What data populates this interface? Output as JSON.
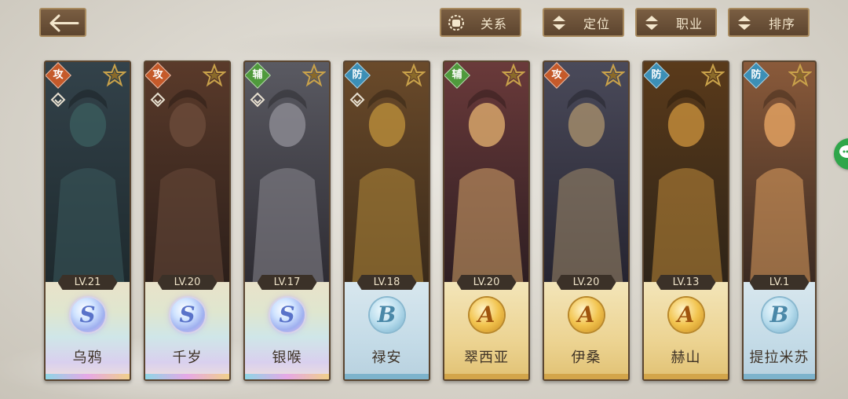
{
  "topbar": {
    "back_icon": "arrow-left-icon",
    "buttons": [
      {
        "label": "关系",
        "icon": "gear-hand-icon"
      },
      {
        "label": "定位",
        "icon": "sort-updown-icon"
      },
      {
        "label": "职业",
        "icon": "sort-updown-icon"
      },
      {
        "label": "排序",
        "icon": "sort-updown-icon"
      }
    ]
  },
  "heroes": [
    {
      "name": "乌鸦",
      "role": "攻",
      "level": "LV.21",
      "grade": "S"
    },
    {
      "name": "千岁",
      "role": "攻",
      "level": "LV.20",
      "grade": "S"
    },
    {
      "name": "银喉",
      "role": "辅",
      "level": "LV.17",
      "grade": "S"
    },
    {
      "name": "禄安",
      "role": "防",
      "level": "LV.18",
      "grade": "B"
    },
    {
      "name": "翠西亚",
      "role": "辅",
      "level": "LV.20",
      "grade": "A"
    },
    {
      "name": "伊桑",
      "role": "攻",
      "level": "LV.20",
      "grade": "A"
    },
    {
      "name": "赫山",
      "role": "防",
      "level": "LV.13",
      "grade": "A"
    },
    {
      "name": "提拉米苏",
      "role": "防",
      "level": "LV.1",
      "grade": "B"
    }
  ],
  "colors": {
    "attack": "#c55a2a",
    "support": "#4f9a3c",
    "defense": "#3c8fb6",
    "button_bg": "#6b513a",
    "button_text": "#f3e6cc"
  },
  "side_icon": "chat-bubble-icon"
}
